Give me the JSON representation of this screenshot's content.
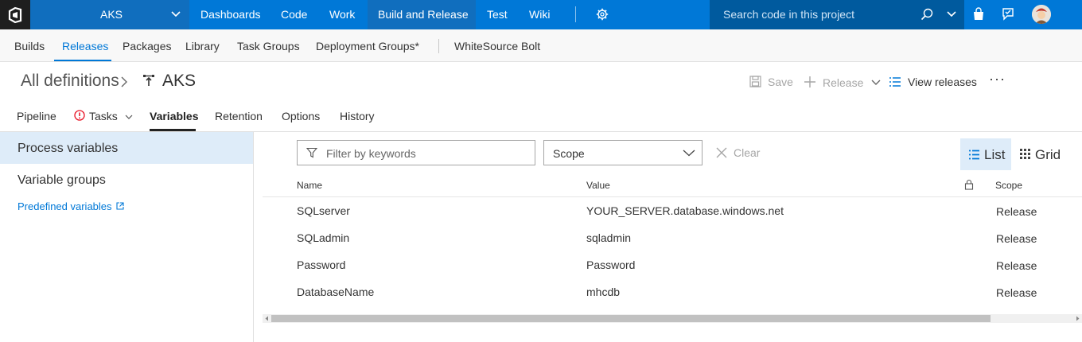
{
  "topnav": {
    "project": "AKS",
    "hubs": [
      "Dashboards",
      "Code",
      "Work",
      "Build and Release",
      "Test",
      "Wiki"
    ],
    "active_hub": "Build and Release",
    "search_placeholder": "Search code in this project",
    "icons": [
      "vsts-logo-icon",
      "chevron-down-icon",
      "gear-icon",
      "search-icon",
      "shopping-bag-icon",
      "feedback-icon",
      "avatar"
    ]
  },
  "subnav": {
    "items": [
      "Builds",
      "Releases",
      "Packages",
      "Library",
      "Task Groups",
      "Deployment Groups*",
      "WhiteSource Bolt"
    ],
    "active": "Releases"
  },
  "header": {
    "breadcrumb_root": "All definitions",
    "title": "AKS",
    "commands": {
      "save": "Save",
      "release": "Release",
      "view_releases": "View releases"
    }
  },
  "tabs": {
    "items": [
      "Pipeline",
      "Tasks",
      "Variables",
      "Retention",
      "Options",
      "History"
    ],
    "active": "Variables"
  },
  "leftpanel": {
    "items": [
      "Process variables",
      "Variable groups"
    ],
    "selected": "Process variables",
    "link": "Predefined variables"
  },
  "toolbar": {
    "filter_placeholder": "Filter by keywords",
    "scope_label": "Scope",
    "clear_label": "Clear",
    "list_label": "List",
    "grid_label": "Grid"
  },
  "table": {
    "columns": [
      "Name",
      "Value",
      "Scope"
    ],
    "rows": [
      {
        "name": "SQLserver",
        "value": "YOUR_SERVER.database.windows.net",
        "scope": "Release"
      },
      {
        "name": "SQLadmin",
        "value": "sqladmin",
        "scope": "Release"
      },
      {
        "name": "Password",
        "value": "Password",
        "scope": "Release"
      },
      {
        "name": "DatabaseName",
        "value": "mhcdb",
        "scope": "Release"
      }
    ]
  },
  "colors": {
    "accent": "#0078d7",
    "topbar": "#0078d7",
    "selected_bg": "#deecf9"
  }
}
